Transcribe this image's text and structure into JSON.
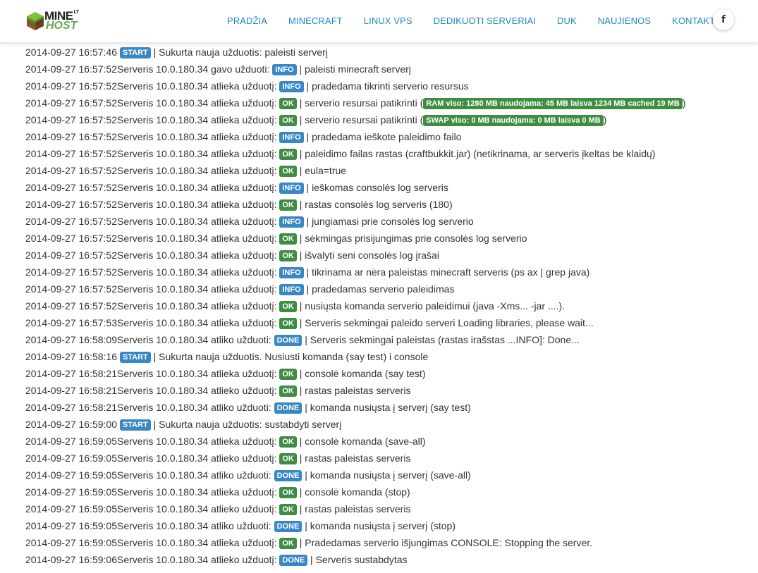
{
  "header": {
    "logo_line1": "MINE",
    "logo_sup": "LT",
    "logo_line2": "HOST",
    "nav": [
      "PRADŽIA",
      "MINECRAFT",
      "LINUX VPS",
      "DEDIKUOTI SERVERIAI",
      "DUK",
      "NAUJIENOS",
      "KONTAKTAI"
    ],
    "social_icon": "facebook-icon",
    "social_label": "f"
  },
  "colors": {
    "link": "#1f86c6",
    "badge_blue": "#3a87c5",
    "badge_green": "#3e8e41",
    "logo_green": "#6aa84f"
  },
  "log": [
    {
      "ts": "2014-09-27 16:57:46",
      "pre": "",
      "badge": "START",
      "type": "start",
      "msg": " | Sukurta nauja užduotis: paleisti serverį"
    },
    {
      "ts": "2014-09-27 16:57:52",
      "pre": "Serveris 10.0.180.34 gavo užduoti: ",
      "badge": "INFO",
      "type": "info",
      "msg": " | paleisti minecraft serverį"
    },
    {
      "ts": "2014-09-27 16:57:52",
      "pre": "Serveris 10.0.180.34 atlieka užduotį: ",
      "badge": "INFO",
      "type": "info",
      "msg": " | pradedama tikrinti serverio resursus"
    },
    {
      "ts": "2014-09-27 16:57:52",
      "pre": "Serveris 10.0.180.34 atlieka užduotį: ",
      "badge": "OK",
      "type": "ok",
      "msg": " | serverio resursai patikrinti (",
      "res": "RAM viso: 1280 MB naudojama: 45 MB laisva 1234 MB cached 19 MB",
      "post": ")"
    },
    {
      "ts": "2014-09-27 16:57:52",
      "pre": "Serveris 10.0.180.34 atlieka užduotį: ",
      "badge": "OK",
      "type": "ok",
      "msg": " | serverio resursai patikrinti (",
      "res": "SWAP viso: 0 MB naudojama: 0 MB laisva 0 MB",
      "post": ")"
    },
    {
      "ts": "2014-09-27 16:57:52",
      "pre": "Serveris 10.0.180.34 atlieka užduotį: ",
      "badge": "INFO",
      "type": "info",
      "msg": " | pradedama ieškote paleidimo failo"
    },
    {
      "ts": "2014-09-27 16:57:52",
      "pre": "Serveris 10.0.180.34 atlieka užduotį: ",
      "badge": "OK",
      "type": "ok",
      "msg": " | paleidimo failas rastas (craftbukkit.jar) (netikrinama, ar serveris įkeltas be klaidų)"
    },
    {
      "ts": "2014-09-27 16:57:52",
      "pre": "Serveris 10.0.180.34 atlieka užduotį: ",
      "badge": "OK",
      "type": "ok",
      "msg": " | eula=true"
    },
    {
      "ts": "2014-09-27 16:57:52",
      "pre": "Serveris 10.0.180.34 atlieka užduotį: ",
      "badge": "INFO",
      "type": "info",
      "msg": " | ieškomas consolės log serveris"
    },
    {
      "ts": "2014-09-27 16:57:52",
      "pre": "Serveris 10.0.180.34 atlieka užduotį: ",
      "badge": "OK",
      "type": "ok",
      "msg": " | rastas consolės log serveris (180)"
    },
    {
      "ts": "2014-09-27 16:57:52",
      "pre": "Serveris 10.0.180.34 atlieka užduotį: ",
      "badge": "INFO",
      "type": "info",
      "msg": " | jungiamasi prie consolės log serverio"
    },
    {
      "ts": "2014-09-27 16:57:52",
      "pre": "Serveris 10.0.180.34 atlieka užduotį: ",
      "badge": "OK",
      "type": "ok",
      "msg": " | sėkmingas prisijungimas prie consolės log serverio"
    },
    {
      "ts": "2014-09-27 16:57:52",
      "pre": "Serveris 10.0.180.34 atlieka užduotį: ",
      "badge": "OK",
      "type": "ok",
      "msg": " | išvalyti seni consolės log įrašai"
    },
    {
      "ts": "2014-09-27 16:57:52",
      "pre": "Serveris 10.0.180.34 atlieka užduotį: ",
      "badge": "INFO",
      "type": "info",
      "msg": " | tikrinama ar nėra paleistas minecraft serveris (ps ax | grep java)"
    },
    {
      "ts": "2014-09-27 16:57:52",
      "pre": "Serveris 10.0.180.34 atlieka užduotį: ",
      "badge": "INFO",
      "type": "info",
      "msg": " | pradedamas serverio paleidimas"
    },
    {
      "ts": "2014-09-27 16:57:52",
      "pre": "Serveris 10.0.180.34 atlieka užduotį: ",
      "badge": "OK",
      "type": "ok",
      "msg": " | nusiųsta komanda serverio paleidimui (java -Xms... -jar ....)."
    },
    {
      "ts": "2014-09-27 16:57:53",
      "pre": "Serveris 10.0.180.34 atlieka užduotį: ",
      "badge": "OK",
      "type": "ok",
      "msg": " | Serveris sekmingai paleido serveri Loading libraries, please wait..."
    },
    {
      "ts": "2014-09-27 16:58:09",
      "pre": "Serveris 10.0.180.34 atliko užduoti: ",
      "badge": "DONE",
      "type": "done",
      "msg": " | Serveris sekmingai paleistas (rastas irašstas ...INFO]: Done..."
    },
    {
      "ts": "2014-09-27 16:58:16",
      "pre": "",
      "badge": "START",
      "type": "start",
      "msg": " | Sukurta nauja užduotis. Nusiusti komanda (say test) i console"
    },
    {
      "ts": "2014-09-27 16:58:21",
      "pre": "Serveris 10.0.180.34 atlieka užduotį: ",
      "badge": "OK",
      "type": "ok",
      "msg": " | consolė komanda (say test)"
    },
    {
      "ts": "2014-09-27 16:58:21",
      "pre": "Serveris 10.0.180.34 atlieko užduotį: ",
      "badge": "OK",
      "type": "ok",
      "msg": " | rastas paleistas serveris"
    },
    {
      "ts": "2014-09-27 16:58:21",
      "pre": "Serveris 10.0.180.34 atliko užduoti: ",
      "badge": "DONE",
      "type": "done",
      "msg": " | komanda nusiųsta į serverį (say test)"
    },
    {
      "ts": "2014-09-27 16:59:00",
      "pre": "",
      "badge": "START",
      "type": "start",
      "msg": " | Sukurta nauja užduotis: sustabdyti serverį"
    },
    {
      "ts": "2014-09-27 16:59:05",
      "pre": "Serveris 10.0.180.34 atlieka užduotį: ",
      "badge": "OK",
      "type": "ok",
      "msg": " | consolė komanda (save-all)"
    },
    {
      "ts": "2014-09-27 16:59:05",
      "pre": "Serveris 10.0.180.34 atlieko užduotį: ",
      "badge": "OK",
      "type": "ok",
      "msg": " | rastas paleistas serveris"
    },
    {
      "ts": "2014-09-27 16:59:05",
      "pre": "Serveris 10.0.180.34 atliko užduoti: ",
      "badge": "DONE",
      "type": "done",
      "msg": " | komanda nusiųsta į serverį (save-all)"
    },
    {
      "ts": "2014-09-27 16:59:05",
      "pre": "Serveris 10.0.180.34 atlieka užduotį: ",
      "badge": "OK",
      "type": "ok",
      "msg": " | consolė komanda (stop)"
    },
    {
      "ts": "2014-09-27 16:59:05",
      "pre": "Serveris 10.0.180.34 atlieko užduotį: ",
      "badge": "OK",
      "type": "ok",
      "msg": " | rastas paleistas serveris"
    },
    {
      "ts": "2014-09-27 16:59:05",
      "pre": "Serveris 10.0.180.34 atliko užduoti: ",
      "badge": "DONE",
      "type": "done",
      "msg": " | komanda nusiųsta į serverį (stop)"
    },
    {
      "ts": "2014-09-27 16:59:05",
      "pre": "Serveris 10.0.180.34 atlieka užduotį: ",
      "badge": "OK",
      "type": "ok",
      "msg": " | Pradedamas serverio išjungimas CONSOLE: Stopping the server."
    },
    {
      "ts": "2014-09-27 16:59:06",
      "pre": "Serveris 10.0.180.34 atlieko užduotį: ",
      "badge": "DONE",
      "type": "done",
      "msg": " | Serveris sustabdytas"
    }
  ]
}
